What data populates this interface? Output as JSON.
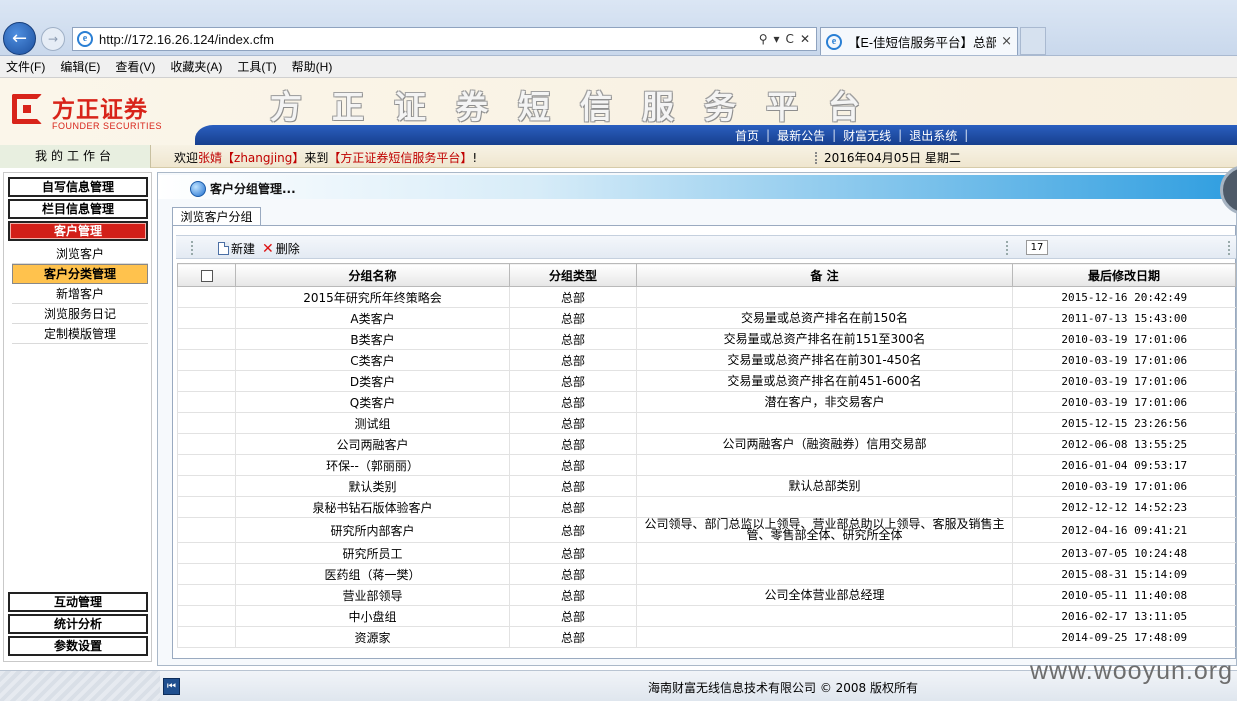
{
  "browser": {
    "url": "http://172.16.26.124/index.cfm",
    "tab_title": "【E-佳短信服务平台】总部...",
    "tab_close": "×",
    "addr_tools": [
      "⚲",
      "▾",
      "C",
      "✕"
    ]
  },
  "menubar": [
    "文件(F)",
    "编辑(E)",
    "查看(V)",
    "收藏夹(A)",
    "工具(T)",
    "帮助(H)"
  ],
  "header": {
    "logo_cn": "方正证券",
    "logo_en": "FOUNDER SECURITIES",
    "platform_title": "方正证券短信服务平台",
    "links": [
      "首页",
      "最新公告",
      "财富无线",
      "退出系统"
    ]
  },
  "welcome": {
    "workbench": "我的工作台",
    "prefix": "欢迎",
    "user_name": "张婧【zhangjing】",
    "mid": "来到",
    "platform": "【方正证券短信服务平台】",
    "suffix": "!",
    "date": "2016年04月05日  星期二"
  },
  "sidebar": {
    "top_menus": [
      "自写信息管理",
      "栏目信息管理",
      "客户管理"
    ],
    "sub_items": [
      "浏览客户",
      "客户分类管理",
      "新增客户",
      "浏览服务日记",
      "定制模版管理"
    ],
    "bottom_menus": [
      "互动管理",
      "统计分析",
      "参数设置"
    ]
  },
  "panel": {
    "title": "客户分组管理...",
    "sub_tab": "浏览客户分组",
    "toolbar": {
      "new": "新建",
      "delete": "删除",
      "page_count": "17"
    },
    "columns": [
      "分组名称",
      "分组类型",
      "备  注",
      "最后修改日期"
    ],
    "rows": [
      [
        "2015年研究所年终策略会",
        "总部",
        "",
        "2015-12-16 20:42:49"
      ],
      [
        "A类客户",
        "总部",
        "交易量或总资产排名在前150名",
        "2011-07-13 15:43:00"
      ],
      [
        "B类客户",
        "总部",
        "交易量或总资产排名在前151至300名",
        "2010-03-19 17:01:06"
      ],
      [
        "C类客户",
        "总部",
        "交易量或总资产排名在前301-450名",
        "2010-03-19 17:01:06"
      ],
      [
        "D类客户",
        "总部",
        "交易量或总资产排名在前451-600名",
        "2010-03-19 17:01:06"
      ],
      [
        "Q类客户",
        "总部",
        "潜在客户，非交易客户",
        "2010-03-19 17:01:06"
      ],
      [
        "测试组",
        "总部",
        "",
        "2015-12-15 23:26:56"
      ],
      [
        "公司两融客户",
        "总部",
        "公司两融客户（融资融券）信用交易部",
        "2012-06-08 13:55:25"
      ],
      [
        "环保--（郭丽丽）",
        "总部",
        "",
        "2016-01-04 09:53:17"
      ],
      [
        "默认类别",
        "总部",
        "默认总部类别",
        "2010-03-19 17:01:06"
      ],
      [
        "泉秘书钻石版体验客户",
        "总部",
        "",
        "2012-12-12 14:52:23"
      ],
      [
        "研究所内部客户",
        "总部",
        "公司领导、部门总监以上领导、营业部总助以上领导、客服及销售主管、零售部全体、研究所全体",
        "2012-04-16 09:41:21"
      ],
      [
        "研究所员工",
        "总部",
        "",
        "2013-07-05 10:24:48"
      ],
      [
        "医药组（蒋一樊）",
        "总部",
        "",
        "2015-08-31 15:14:09"
      ],
      [
        "营业部领导",
        "总部",
        "公司全体营业部总经理",
        "2010-05-11 11:40:08"
      ],
      [
        "中小盘组",
        "总部",
        "",
        "2016-02-17 13:11:05"
      ],
      [
        "资源家",
        "总部",
        "",
        "2014-09-25 17:48:09"
      ]
    ]
  },
  "footer": {
    "copyright": "海南财富无线信息技术有限公司 © 2008 版权所有",
    "collapse_glyph": "⏮",
    "watermark": "www.wooyun.org"
  },
  "colors": {
    "brand_red": "#d8241a",
    "nav_blue": "#1f4f9e",
    "active_yellow": "#ffc24d"
  }
}
